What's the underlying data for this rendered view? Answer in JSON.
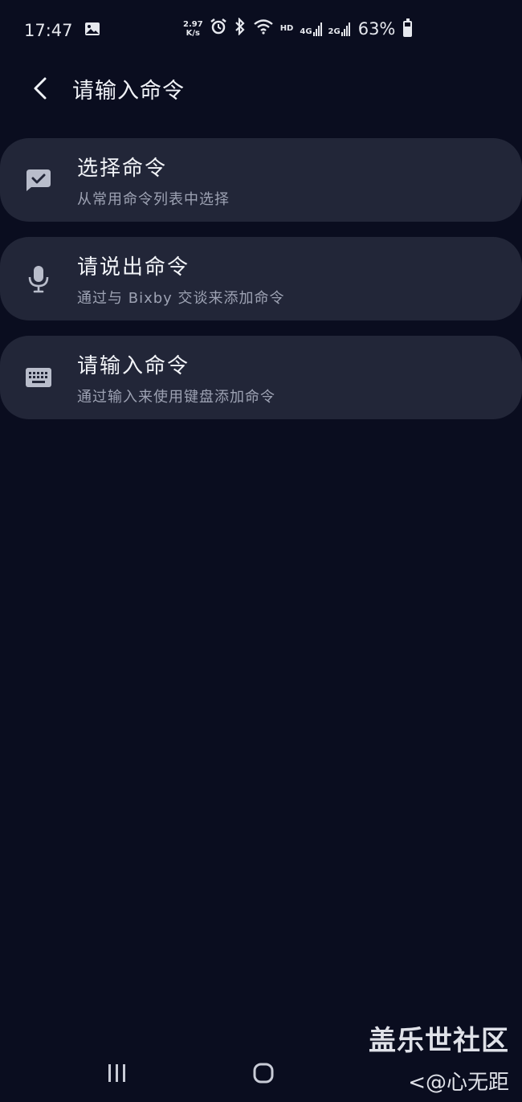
{
  "status_bar": {
    "time": "17:47",
    "net_speed_value": "2.97",
    "net_speed_unit": "K/s",
    "hd_label": "HD",
    "sim1_label": "4G",
    "sim2_label": "2G",
    "battery_percent": "63%",
    "battery_level": 0.63
  },
  "header": {
    "title": "请输入命令"
  },
  "options": [
    {
      "title": "选择命令",
      "subtitle": "从常用命令列表中选择",
      "icon": "chat-check-icon"
    },
    {
      "title": "请说出命令",
      "subtitle": "通过与 Bixby 交谈来添加命令",
      "icon": "microphone-icon"
    },
    {
      "title": "请输入命令",
      "subtitle": "通过输入来使用键盘添加命令",
      "icon": "keyboard-icon"
    }
  ],
  "watermark": {
    "title": "盖乐世社区",
    "subtitle": "<@心无距"
  },
  "colors": {
    "background": "#0a0d1f",
    "card": "#222638",
    "icon": "#b9bdcb"
  }
}
